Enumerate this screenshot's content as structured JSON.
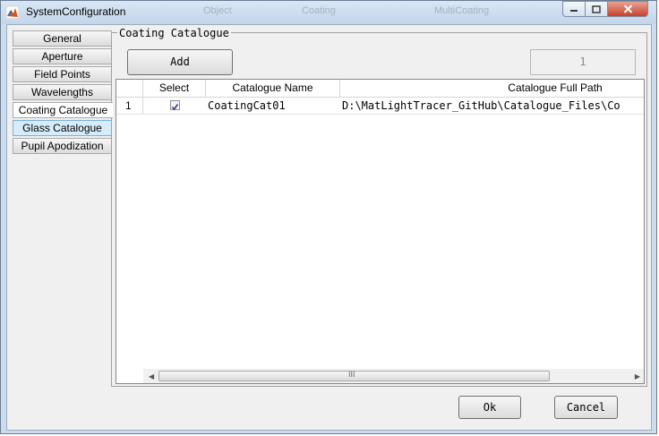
{
  "window": {
    "title": "SystemConfiguration",
    "background_ghost_labels": [
      "Object",
      "Coating",
      "MultiCoating"
    ]
  },
  "tabs": [
    {
      "label": "General"
    },
    {
      "label": "Aperture"
    },
    {
      "label": "Field Points"
    },
    {
      "label": "Wavelengths"
    },
    {
      "label": "Coating Catalogue",
      "state": "active"
    },
    {
      "label": "Glass Catalogue",
      "state": "hover"
    },
    {
      "label": "Pupil Apodization"
    }
  ],
  "panel": {
    "title": "Coating Catalogue",
    "add_label": "Add",
    "count_value": "1"
  },
  "table": {
    "columns": [
      "",
      "Select",
      "Catalogue Name",
      "Catalogue Full Path"
    ],
    "rows": [
      {
        "index": "1",
        "selected": true,
        "name": "CoatingCat01",
        "path": "D:\\MatLightTracer_GitHub\\Catalogue_Files\\Co"
      }
    ],
    "scroll_grip": "III"
  },
  "footer": {
    "ok_label": "Ok",
    "cancel_label": "Cancel"
  },
  "colors": {
    "titlebar": "#c3d6ea",
    "close_button": "#c7412a",
    "hover_tab": "#d6ecfb"
  }
}
